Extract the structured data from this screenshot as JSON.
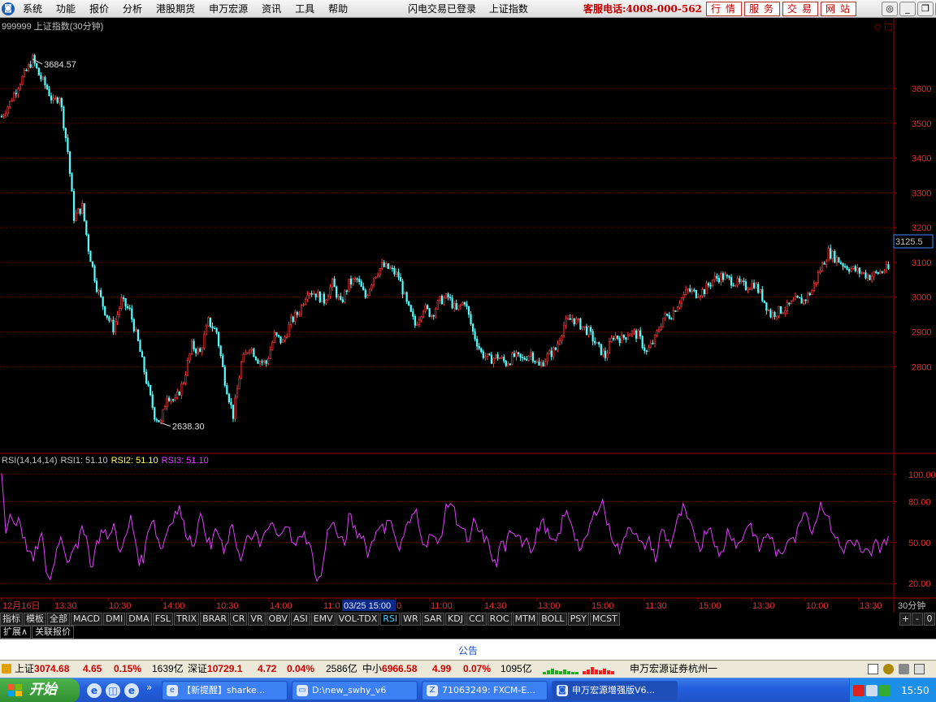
{
  "menubar": {
    "logo": "◙",
    "items": [
      "系统",
      "功能",
      "报价",
      "分析",
      "港股期货",
      "申万宏源",
      "资讯",
      "工具",
      "帮助"
    ],
    "login_status": "闪电交易已登录",
    "current_index": "上证指数",
    "hotline": "客服电话:4008-000-562",
    "buttons": [
      "行情",
      "服务",
      "交易",
      "网站"
    ],
    "window_controls": [
      "◎",
      "_",
      "❐",
      "✕"
    ]
  },
  "chart_header": {
    "code": "999999",
    "name": "上证指数(30分钟)"
  },
  "rsi_header": {
    "label": "RSI(14,14,14)",
    "rsi1_label": "RSI1: 51.10",
    "rsi2_label": "RSI2: 51.10",
    "rsi3_label": "RSI3: 51.10"
  },
  "chart_data": [
    {
      "type": "candlestick",
      "title": "999999 上证指数(30分钟)",
      "ylim": [
        2560,
        3780
      ],
      "yticks": [
        2800,
        2900,
        3000,
        3100,
        3200,
        3300,
        3400,
        3500,
        3600
      ],
      "current_price": "3125.5",
      "max_label": "3684.57",
      "min_label": "2638.30",
      "close_path": [
        [
          0,
          3520
        ],
        [
          4,
          3560
        ],
        [
          8,
          3610
        ],
        [
          12,
          3650
        ],
        [
          15,
          3684.57
        ],
        [
          18,
          3640
        ],
        [
          22,
          3600
        ],
        [
          25,
          3560
        ],
        [
          28,
          3580
        ],
        [
          32,
          3420
        ],
        [
          35,
          3230
        ],
        [
          39,
          3260
        ],
        [
          42,
          3140
        ],
        [
          46,
          3030
        ],
        [
          50,
          2960
        ],
        [
          54,
          2910
        ],
        [
          58,
          2990
        ],
        [
          62,
          2960
        ],
        [
          66,
          2870
        ],
        [
          70,
          2760
        ],
        [
          74,
          2660
        ],
        [
          77,
          2638.3
        ],
        [
          80,
          2720
        ],
        [
          84,
          2700
        ],
        [
          88,
          2760
        ],
        [
          92,
          2860
        ],
        [
          96,
          2840
        ],
        [
          100,
          2930
        ],
        [
          104,
          2900
        ],
        [
          108,
          2760
        ],
        [
          112,
          2660
        ],
        [
          116,
          2810
        ],
        [
          120,
          2860
        ],
        [
          124,
          2820
        ],
        [
          128,
          2810
        ],
        [
          132,
          2890
        ],
        [
          136,
          2870
        ],
        [
          140,
          2930
        ],
        [
          144,
          2960
        ],
        [
          148,
          3020
        ],
        [
          152,
          3010
        ],
        [
          156,
          2990
        ],
        [
          160,
          3040
        ],
        [
          164,
          2980
        ],
        [
          168,
          3040
        ],
        [
          172,
          3050
        ],
        [
          176,
          3000
        ],
        [
          180,
          3060
        ],
        [
          184,
          3090
        ],
        [
          188,
          3080
        ],
        [
          192,
          3060
        ],
        [
          196,
          2980
        ],
        [
          200,
          2920
        ],
        [
          204,
          2970
        ],
        [
          208,
          2950
        ],
        [
          212,
          2990
        ],
        [
          216,
          3000
        ],
        [
          220,
          2960
        ],
        [
          224,
          2990
        ],
        [
          228,
          2900
        ],
        [
          232,
          2840
        ],
        [
          236,
          2820
        ],
        [
          240,
          2830
        ],
        [
          244,
          2810
        ],
        [
          248,
          2830
        ],
        [
          252,
          2820
        ],
        [
          256,
          2840
        ],
        [
          260,
          2800
        ],
        [
          264,
          2830
        ],
        [
          268,
          2850
        ],
        [
          272,
          2920
        ],
        [
          276,
          2940
        ],
        [
          280,
          2920
        ],
        [
          284,
          2900
        ],
        [
          288,
          2860
        ],
        [
          292,
          2830
        ],
        [
          296,
          2890
        ],
        [
          300,
          2880
        ],
        [
          304,
          2900
        ],
        [
          308,
          2890
        ],
        [
          312,
          2840
        ],
        [
          316,
          2880
        ],
        [
          320,
          2940
        ],
        [
          324,
          2950
        ],
        [
          328,
          2990
        ],
        [
          332,
          3020
        ],
        [
          336,
          3010
        ],
        [
          340,
          3020
        ],
        [
          344,
          3050
        ],
        [
          348,
          3060
        ],
        [
          352,
          3050
        ],
        [
          356,
          3040
        ],
        [
          360,
          3030
        ],
        [
          364,
          3040
        ],
        [
          368,
          3000
        ],
        [
          372,
          2950
        ],
        [
          376,
          2960
        ],
        [
          380,
          2970
        ],
        [
          384,
          2990
        ],
        [
          388,
          2990
        ],
        [
          392,
          3020
        ],
        [
          396,
          3080
        ],
        [
          400,
          3130
        ],
        [
          404,
          3110
        ],
        [
          408,
          3090
        ],
        [
          412,
          3080
        ],
        [
          416,
          3070
        ],
        [
          420,
          3060
        ],
        [
          424,
          3070
        ],
        [
          428,
          3080
        ]
      ],
      "x_labels": [
        "12月16日",
        "13:30",
        "10:30",
        "14:00",
        "10:30",
        "14:00",
        "11:0",
        "0",
        "11:00",
        "14:30",
        "13:00",
        "15:00",
        "11:30",
        "15:00",
        "13:30",
        "10:00",
        "13:30"
      ],
      "cursor_label": "03/25 15:00",
      "period_label": "30分钟"
    },
    {
      "type": "line",
      "title": "RSI(14,14,14)",
      "ylim": [
        10,
        110
      ],
      "yticks": [
        20,
        50,
        80,
        100
      ],
      "series": [
        {
          "name": "RSI1",
          "color": "#e040fb",
          "values": [
            100,
            58,
            72,
            62,
            70,
            52,
            45,
            35,
            48,
            55,
            30,
            22,
            40,
            55,
            48,
            35,
            50,
            42,
            62,
            58,
            30,
            45,
            55,
            62,
            48,
            66,
            50,
            44,
            55,
            68,
            52,
            35,
            40,
            62,
            70,
            52,
            45,
            58,
            66,
            72,
            75,
            60,
            55,
            48,
            62,
            70,
            55,
            45,
            62,
            52,
            40,
            56,
            60,
            45,
            38,
            55,
            48,
            62,
            42,
            58,
            60,
            64,
            50,
            62,
            66,
            52,
            45,
            58,
            55,
            50,
            35,
            20,
            30,
            55,
            68,
            58,
            52,
            48,
            70,
            62,
            55,
            58,
            42,
            48,
            58,
            66,
            55,
            72,
            60,
            42,
            54,
            62,
            66,
            75,
            60,
            45,
            58,
            52,
            48,
            62,
            78,
            80,
            68,
            62,
            56,
            48,
            66,
            58,
            55,
            50,
            42,
            30,
            52,
            46,
            55,
            54,
            60,
            48,
            58,
            40,
            55,
            66,
            62,
            52,
            48,
            55,
            68,
            72,
            64,
            52,
            44,
            50,
            62,
            70,
            78,
            80,
            62,
            55,
            48,
            42,
            58,
            64,
            58,
            50,
            46,
            52,
            48,
            34,
            62,
            55,
            48,
            58,
            68,
            75,
            66,
            58,
            52,
            46,
            60,
            62,
            52,
            38,
            46,
            60,
            55,
            48,
            50,
            62,
            64,
            55,
            45,
            52,
            58,
            50,
            42,
            38,
            50,
            58,
            52,
            62,
            76,
            68,
            58,
            70,
            80,
            72,
            62,
            56,
            48,
            42,
            55,
            46,
            52,
            38,
            44,
            40,
            50,
            46,
            52,
            51.1
          ]
        }
      ]
    }
  ],
  "indicator_tabs": [
    "指标",
    "模板",
    "全部",
    "MACD",
    "DMI",
    "DMA",
    "FSL",
    "TRIX",
    "BRAR",
    "CR",
    "VR",
    "OBV",
    "ASI",
    "EMV",
    "VOL-TDX",
    "RSI",
    "WR",
    "SAR",
    "KDJ",
    "CCI",
    "ROC",
    "MTM",
    "BOLL",
    "PSY",
    "MCST"
  ],
  "selected_tab": "RSI",
  "tab_nav": [
    "+",
    "-",
    "0"
  ],
  "sub_tabs": [
    "扩展∧",
    "关联报价"
  ],
  "notice": "公告",
  "status_bar": {
    "sh_label": "上证",
    "sh_value": "3074.68",
    "sh_change": "4.65",
    "sh_pct": "0.15%",
    "sh_volume": "1639亿",
    "sz_label": "深证",
    "sz_value": "10729.1",
    "sz_change": "4.72",
    "sz_pct": "0.04%",
    "sz_volume": "2586亿",
    "zx_label": "中小",
    "zx_value": "6966.58",
    "zx_change": "4.99",
    "zx_pct": "0.07%",
    "zx_volume": "1095亿",
    "broker": "申万宏源证券杭州一"
  },
  "taskbar": {
    "start_label": "开始",
    "chevron": "»",
    "tasks": [
      {
        "label": "【新提醒】sharke...",
        "icon": "e"
      },
      {
        "label": "D:\\new_swhy_v6",
        "icon": "▭"
      },
      {
        "label": "71063249: FXCM-E...",
        "icon": "Z"
      },
      {
        "label": "申万宏源增强版V6...",
        "icon": "◙"
      }
    ],
    "clock": "15:50"
  },
  "colors": {
    "up": "#ff3c3c",
    "down": "#54ffff",
    "axis": "#a00000",
    "grid": "#7a0000",
    "rsi": "#e040fb",
    "rsi2_label": "#ffff54",
    "label_text": "#c0c0c0"
  }
}
